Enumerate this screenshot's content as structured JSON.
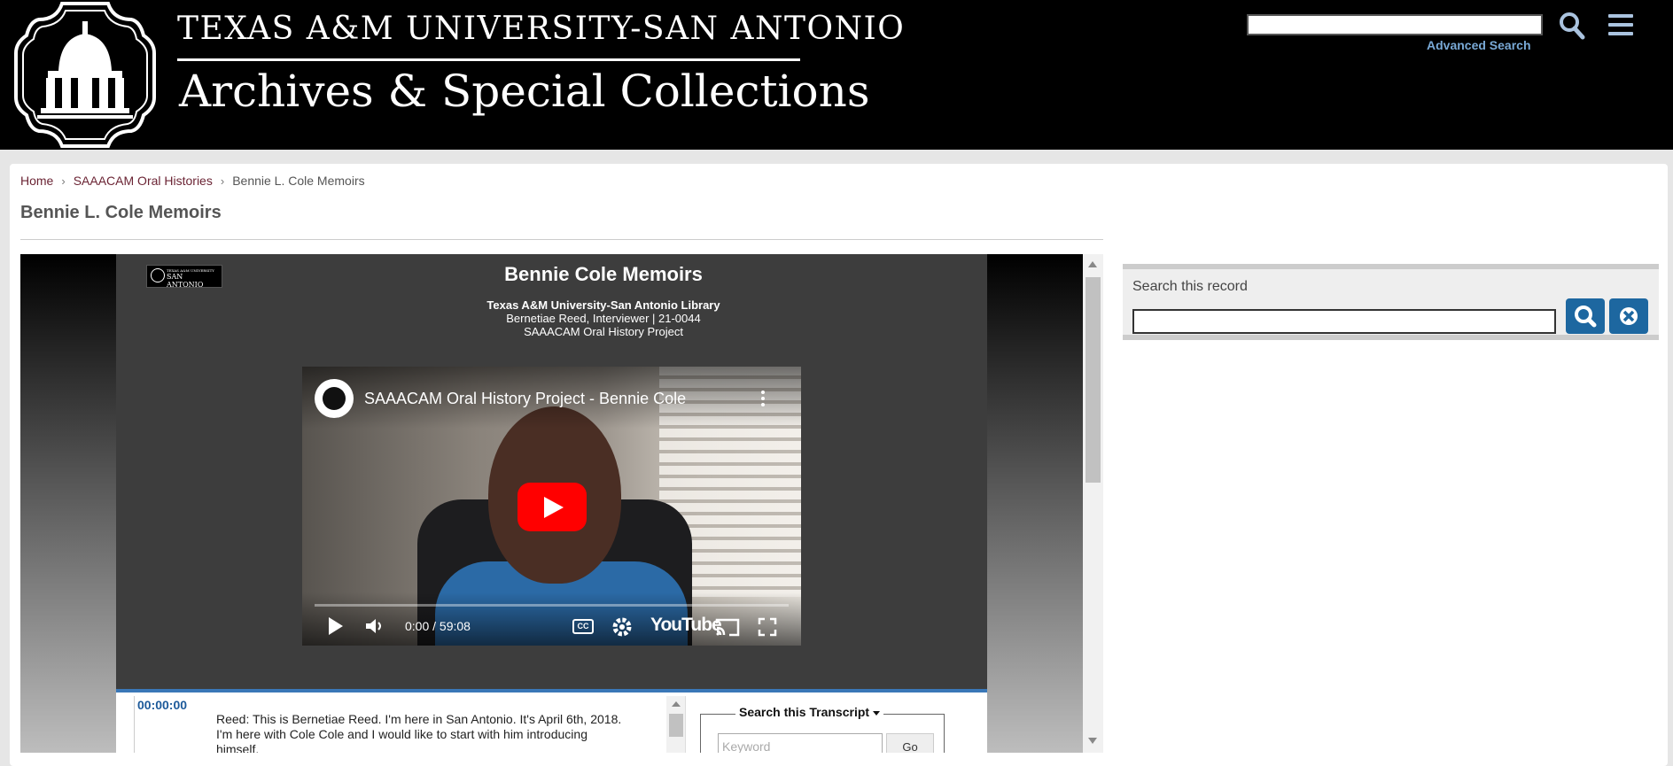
{
  "header": {
    "university": "TEXAS A&M UNIVERSITY-SAN ANTONIO",
    "site_title": "Archives & Special Collections",
    "advanced_search": "Advanced Search",
    "search_value": ""
  },
  "breadcrumb": [
    "Home",
    "SAAACAM Oral Histories",
    "Bennie L. Cole Memoirs"
  ],
  "page_title": "Bennie L. Cole Memoirs",
  "viewer": {
    "mini_logo_top": "TEXAS A&M UNIVERSITY",
    "mini_logo": "SAN ANTONIO",
    "title": "Bennie Cole Memoirs",
    "library": "Texas A&M University-San Antonio Library",
    "interviewer": "Bernetiae Reed, Interviewer | 21-0044",
    "project": "SAAACAM Oral History Project"
  },
  "video": {
    "title": "SAAACAM Oral History Project - Bennie Cole",
    "time": "0:00 / 59:08",
    "progress": 0,
    "cc": "CC",
    "brand": "YouTube"
  },
  "transcript": {
    "timestamp": "00:00:00",
    "text": "Reed: This is Bernetiae Reed. I'm here in San Antonio. It's April 6th, 2018. I'm here with Cole Cole and I would like to start with him introducing himself.",
    "search_legend": "Search this Transcript",
    "keyword_placeholder": "Keyword",
    "go": "Go"
  },
  "sidebar": {
    "search_label": "Search this record",
    "search_value": ""
  },
  "colors": {
    "accent": "#1d67a0",
    "link": "#6b2434",
    "timestamp": "#1d5a9a"
  }
}
